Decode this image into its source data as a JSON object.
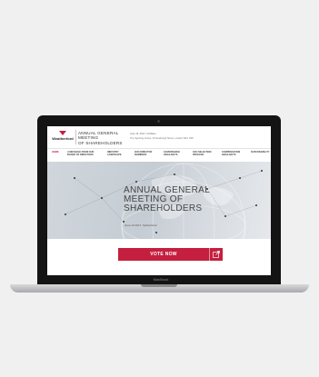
{
  "header": {
    "logo_text": "Weatherford",
    "meeting_title_line1": "ANNUAL GENERAL MEETING",
    "meeting_title_line2": "OF SHAREHOLDERS",
    "event_date": "June 13, 2017 | 10:00am",
    "event_link": "The Sporting Centre, 40 Newburgh Street, London W1F 7RP"
  },
  "nav": {
    "items": [
      "HOME",
      "A MESSAGE FROM OUR BOARD OF DIRECTORS",
      "INDUSTRY LANDSCAPE",
      "2016 DIRECTOR NOMINEES",
      "GOVERNANCE HIGHLIGHTS",
      "CEO SELECTION PROCESS",
      "COMPENSATION HIGHLIGHTS",
      "SUSTAINABILITY"
    ]
  },
  "hero": {
    "title_line1": "ANNUAL GENERAL",
    "title_line2": "MEETING OF",
    "title_line3": "SHAREHOLDERS",
    "date": "June 13 2017, Switzerland"
  },
  "cta": {
    "label": "VOTE NOW",
    "icon": "external-link-icon"
  },
  "device": {
    "brand": "MacBook"
  },
  "colors": {
    "accent": "#c51f3f",
    "background": "#f0f0f1"
  }
}
